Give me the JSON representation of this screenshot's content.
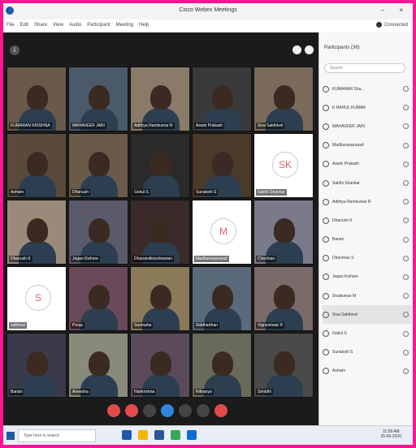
{
  "window": {
    "title": "Cisco Webex Meetings",
    "minimize": "–",
    "close": "×"
  },
  "menu": [
    "File",
    "Edit",
    "Share",
    "View",
    "Audio",
    "Participant",
    "Meeting",
    "Help"
  ],
  "connection": "Connected",
  "video": {
    "tiles": [
      {
        "name": "KUMARAN KRISHNA"
      },
      {
        "name": "MAHAVEER JAIN"
      },
      {
        "name": "Adithya Ramkumar R"
      },
      {
        "name": "Aswin Prakash"
      },
      {
        "name": "Siva Sakthivel"
      },
      {
        "name": "Ashwin"
      },
      {
        "name": "Dhanush"
      },
      {
        "name": "Gokul S"
      },
      {
        "name": "Sunakshi S"
      },
      {
        "name": "Sakthi Shankar",
        "initial": "SK"
      },
      {
        "name": "Dhanush K"
      },
      {
        "name": "Jegan Kishore"
      },
      {
        "name": "Dharunvikneshwaran"
      },
      {
        "name": "Madhavanprasad",
        "initial": "M"
      },
      {
        "name": "Chezhian"
      },
      {
        "name": "vaibhavi",
        "initial": "S"
      },
      {
        "name": "Pooja"
      },
      {
        "name": "Sunmaha"
      },
      {
        "name": "Siddharthan"
      },
      {
        "name": "Vigneshwar R"
      },
      {
        "name": "Barani"
      },
      {
        "name": "Aneesha"
      },
      {
        "name": "Harikrishna"
      },
      {
        "name": "Rithanya"
      },
      {
        "name": "Srinidhi"
      }
    ]
  },
  "panel": {
    "title": "Participants (36)",
    "search_placeholder": "Search",
    "participants": [
      "KUMARAN Sha...",
      "K RAHUL KUMAR",
      "MAHAVEER JAIN",
      "Madhavanprasad",
      "Aswin Prakash",
      "Sakthi Shankar",
      "Adithya Ramkumar R",
      "Dhanush K",
      "Barani",
      "Dharshan S",
      "Jegan Kishore",
      "Sivakumar M",
      "Siva Sakthivel",
      "Gokul S",
      "Sunakshi S",
      "Ashwin"
    ],
    "active_index": 12
  },
  "taskbar": {
    "search": "Type here to search",
    "time": "11:58 AM",
    "date": "25-05-2020"
  },
  "colors": {
    "frame_border": "#ff1493",
    "accent": "#1e5aa8",
    "end_button": "#e34b4b"
  }
}
